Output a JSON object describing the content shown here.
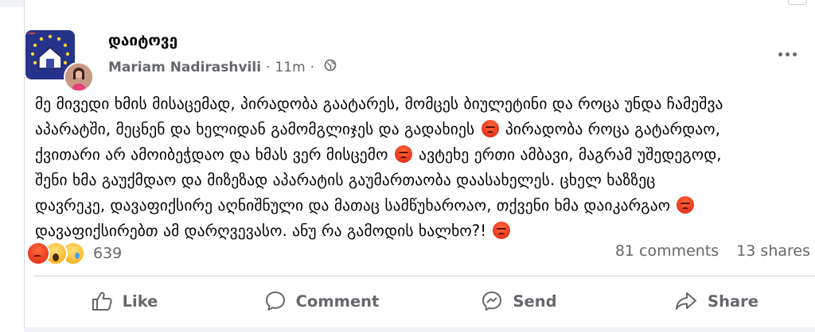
{
  "post": {
    "group_name": "დაიტოვე",
    "author": "Mariam Nadirashvili",
    "time": "11m",
    "separator": "·",
    "lines": [
      "მე მივედი ხმის მისაცემად, პირადობა გაატარეს, მომცეს ბიულეტინი და როცა უნდა ჩამეშვა",
      "აპარატში, მეცნენ და ხელიდან გამომგლიჯეს და გადახიეს",
      "პირადობა როცა გატარდაო,",
      "ქვითარი არ ამოიბეჭდაო და ხმას ვერ მისცემო",
      "ავტეხე ერთი ამბავი, მაგრამ უშედეგოდ,",
      "შენი ხმა გაუქმდაო და მიზეზად აპარატის გაუმართაობა დაასახელეს. ცხელ ხაზზეც",
      "დავრეკე, დავაფიქსირე აღნიშნული და მათაც სამწუხაროაო, თქვენი ხმა დაიკარგაო",
      "დავაფიქსირებთ ამ დარღვევასო. ანუ რა გამოდის ხალხო?!"
    ]
  },
  "icons": {
    "globe": "globe-icon",
    "more": "more-horizontal-icon",
    "angry": "angry-face-emoji",
    "like": "thumbs-up-icon",
    "comment": "speech-bubble-icon",
    "send": "messenger-icon",
    "share": "share-arrow-icon"
  },
  "reactions": {
    "types": [
      "angry",
      "wow",
      "sad"
    ],
    "count": "639"
  },
  "stats": {
    "comments": "81 comments",
    "shares": "13 shares"
  },
  "actions": {
    "like": "Like",
    "comment": "Comment",
    "send": "Send",
    "share": "Share"
  },
  "colors": {
    "text": "#050505",
    "secondary": "#65676b",
    "angry": "#e8351b",
    "wow": "#f7b125"
  }
}
